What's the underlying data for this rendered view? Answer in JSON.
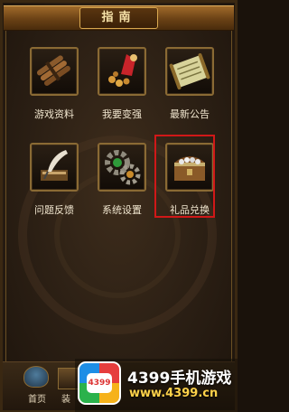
{
  "header": {
    "title": "指南"
  },
  "menu": [
    {
      "label": "游戏资料",
      "icon": "bundle-of-scrolls-icon"
    },
    {
      "label": "我要变强",
      "icon": "potion-bag-icon"
    },
    {
      "label": "最新公告",
      "icon": "notice-scroll-icon"
    },
    {
      "label": "问题反馈",
      "icon": "quill-feather-icon"
    },
    {
      "label": "系统设置",
      "icon": "gears-icon"
    },
    {
      "label": "礼品兑换",
      "icon": "treasure-chest-icon"
    }
  ],
  "highlight": {
    "item": "礼品兑换",
    "color": "#d01818"
  },
  "bottom_nav": {
    "home_label": "首页",
    "second_label": "装"
  },
  "watermark": {
    "logo_text": "4399",
    "title": "4399手机游戏",
    "url": "www.4399.cn"
  }
}
